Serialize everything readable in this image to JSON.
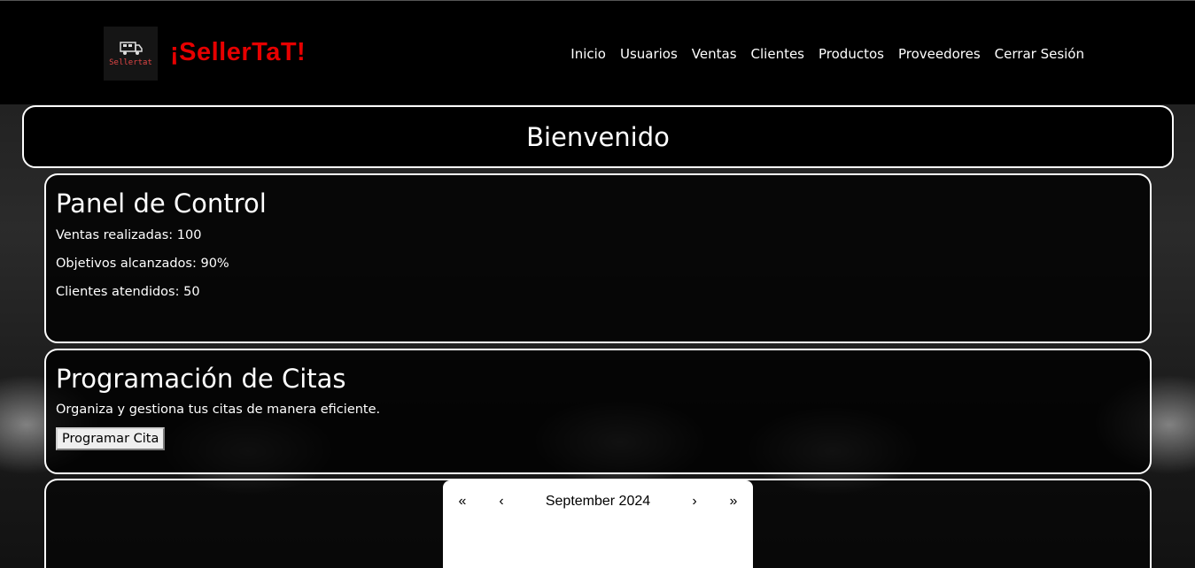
{
  "header": {
    "logo_text": "Sellertat",
    "brand": "¡SellerTaT!",
    "nav": [
      "Inicio",
      "Usuarios",
      "Ventas",
      "Clientes",
      "Productos",
      "Proveedores",
      "Cerrar Sesión"
    ]
  },
  "welcome": {
    "title": "Bienvenido"
  },
  "control_panel": {
    "title": "Panel de Control",
    "stats": [
      "Ventas realizadas: 100",
      "Objetivos alcanzados: 90%",
      "Clientes atendidos: 50"
    ]
  },
  "appointments": {
    "title": "Programación de Citas",
    "description": "Organiza y gestiona tus citas de manera eficiente.",
    "button": "Programar Cita"
  },
  "calendar": {
    "prev_year": "«",
    "prev_month": "‹",
    "label": "September 2024",
    "next_month": "›",
    "next_year": "»"
  },
  "colors": {
    "brand": "#e60000",
    "header_bg": "#000000",
    "panel_border": "#ffffff"
  }
}
